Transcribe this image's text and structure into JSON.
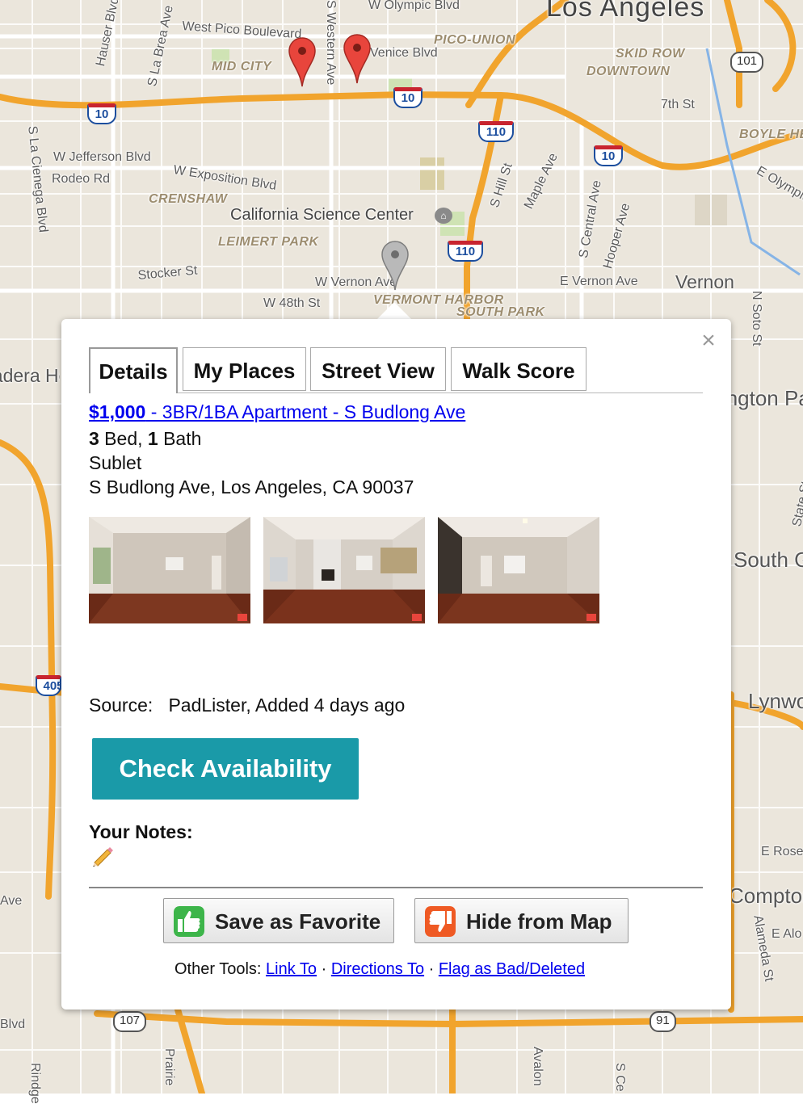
{
  "map": {
    "city_label": "Los Angeles",
    "neighborhoods": [
      "MID CITY",
      "PICO-UNION",
      "SKID ROW",
      "DOWNTOWN",
      "CRENSHAW",
      "LEIMERT PARK",
      "VERMONT HARBOR",
      "SOUTH PARK",
      "BOYLE HE"
    ],
    "streets": [
      "W Olympic Blvd",
      "West Pico Boulevard",
      "Venice Blvd",
      "W Jefferson Blvd",
      "Rodeo Rd",
      "W Exposition Blvd",
      "Stocker St",
      "W Vernon Ave",
      "W 48th St",
      "E Vernon Ave",
      "Hauser Blvd",
      "S La Brea Ave",
      "S La Cienega Blvd",
      "S Western Ave",
      "S Hill St",
      "Maple Ave",
      "S Central Ave",
      "Hooper Ave",
      "7th St",
      "E Olympic",
      "N Soto St",
      "State St",
      "E Rose",
      "E Alo",
      "Alameda St",
      "Avalon",
      "Prairie",
      "Rindge",
      "S Ce",
      "Blvd",
      "Ave"
    ],
    "places": [
      "California Science Center",
      "Vernon",
      "Huntington Park",
      "South Gate",
      "Lynwood",
      "Compton",
      "Ladera Heights"
    ],
    "shields": {
      "i10": "10",
      "i110": "110",
      "i405": "405",
      "us101": "101",
      "ca107": "107",
      "ca91": "91"
    }
  },
  "popup": {
    "close_glyph": "×",
    "tabs": [
      "Details",
      "My Places",
      "Street View",
      "Walk Score"
    ],
    "listing": {
      "price": "$1,000",
      "title_rest": " - 3BR/1BA Apartment - S Budlong Ave",
      "beds_num": "3",
      "beds_label": " Bed, ",
      "baths_num": "1",
      "baths_label": " Bath",
      "type": "Sublet",
      "address": "S Budlong Ave, Los Angeles, CA 90037",
      "source_label": "Source:",
      "source_value": "PadLister, Added 4 days ago"
    },
    "check_availability": "Check Availability",
    "notes_label": "Your Notes:",
    "save_favorite": "Save as Favorite",
    "hide_from_map": "Hide from Map",
    "other_tools_label": "Other Tools:",
    "tools": [
      "Link To",
      "Directions To",
      "Flag as Bad/Deleted"
    ],
    "separator": " · "
  }
}
